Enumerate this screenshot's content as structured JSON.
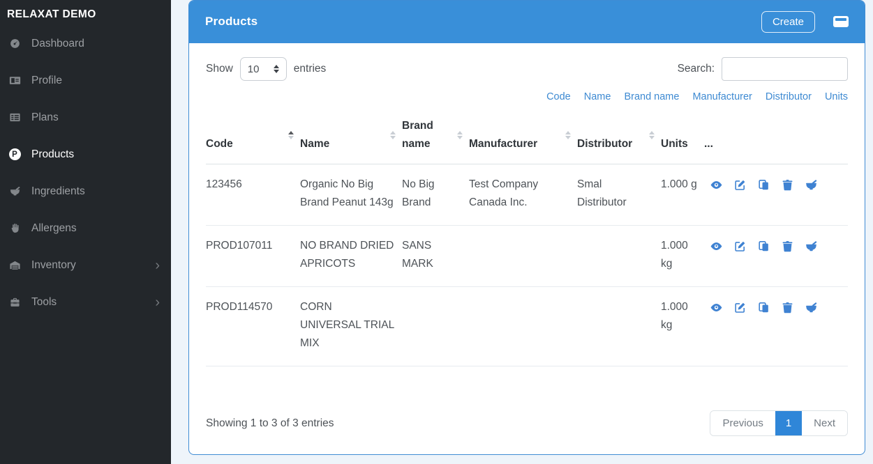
{
  "colors": {
    "primary_blue": "#398fd9",
    "sidebar_bg": "#23272b",
    "link_blue": "#3e8ad2",
    "action_icon_blue": "#3f82d2",
    "pagination_active": "#2f86d8"
  },
  "icons": {
    "chevron_right": "›",
    "products_badge": "P"
  },
  "sidebar": {
    "brand": "RELAXAT DEMO",
    "items": [
      {
        "label": "Dashboard"
      },
      {
        "label": "Profile"
      },
      {
        "label": "Plans"
      },
      {
        "label": "Products"
      },
      {
        "label": "Ingredients"
      },
      {
        "label": "Allergens"
      },
      {
        "label": "Inventory"
      },
      {
        "label": "Tools"
      }
    ]
  },
  "header": {
    "title": "Products",
    "create_label": "Create"
  },
  "controls": {
    "show_label": "Show",
    "page_length": "10",
    "entries_label": "entries",
    "search_label": "Search:",
    "search_value": ""
  },
  "filter_links": [
    "Code",
    "Name",
    "Brand name",
    "Manufacturer",
    "Distributor",
    "Units"
  ],
  "table": {
    "columns": [
      {
        "label": "Code",
        "sort": "asc"
      },
      {
        "label": "Name",
        "sort": "unsorted"
      },
      {
        "label": "Brand name",
        "sort": "unsorted"
      },
      {
        "label": "Manufacturer",
        "sort": "unsorted"
      },
      {
        "label": "Distributor",
        "sort": "unsorted"
      },
      {
        "label": "Units",
        "sort": "none"
      },
      {
        "label": "...",
        "sort": "none"
      }
    ],
    "rows": [
      {
        "code": "123456",
        "name": "Organic No Big Brand Peanut 143g",
        "brand": "No Big Brand",
        "manufacturer": "Test Company Canada Inc.",
        "distributor": "Smal Distributor",
        "units": "1.000 g"
      },
      {
        "code": "PROD107011",
        "name": "NO BRAND DRIED APRICOTS",
        "brand": "SANS MARK",
        "manufacturer": "",
        "distributor": "",
        "units": "1.000 kg"
      },
      {
        "code": "PROD114570",
        "name": "CORN UNIVERSAL TRIAL MIX",
        "brand": "",
        "manufacturer": "",
        "distributor": "",
        "units": "1.000 kg"
      }
    ]
  },
  "footer": {
    "summary": "Showing 1 to 3 of 3 entries",
    "pagination": {
      "previous": "Previous",
      "current_page": "1",
      "next": "Next"
    }
  }
}
